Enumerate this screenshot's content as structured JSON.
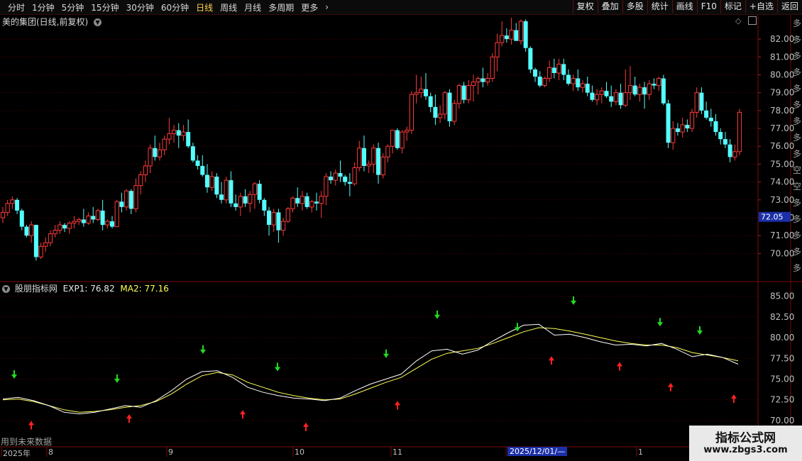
{
  "toolbar": {
    "periods": [
      "分时",
      "1分钟",
      "5分钟",
      "15分钟",
      "30分钟",
      "60分钟",
      "日线",
      "周线",
      "月线",
      "多周期",
      "更多"
    ],
    "active_period": "日线",
    "right_buttons": [
      "复权",
      "叠加",
      "多股",
      "统计",
      "画线",
      "F10",
      "标记",
      "+自选",
      "返回"
    ]
  },
  "main_panel": {
    "title": "美的集团(日线,前复权)",
    "price_axis": [
      "82.00",
      "81.00",
      "80.00",
      "79.00",
      "78.00",
      "77.00",
      "76.00",
      "75.00",
      "74.00",
      "73.00",
      "72.00",
      "71.00",
      "70.00"
    ],
    "current_price_tag": "72.05",
    "side_text": "多多多多多多多多多空空多多多多多多多多多"
  },
  "indicator_panel": {
    "name": "股朋指标网",
    "exp1_label": "EXP1:",
    "exp1_value": "76.82",
    "ma2_label": "MA2:",
    "ma2_value": "77.16",
    "axis": [
      "85.00",
      "82.50",
      "80.00",
      "77.50",
      "75.00",
      "72.50",
      "70.00"
    ],
    "note": "用到未来数据"
  },
  "date_axis": {
    "labels": [
      "2025年",
      "8",
      "9",
      "10",
      "11",
      "2025/12/01/—",
      "1"
    ]
  },
  "watermark": {
    "line1": "指标公式网",
    "line2": "www.zbgs3.com"
  },
  "colors": {
    "up": "#ff3b3b",
    "down": "#54ffff",
    "exp_line": "#ffffff",
    "ma_line": "#ffff55",
    "buy_arrow": "#ff2222",
    "sell_arrow": "#22dd22",
    "grid": "#5a0000"
  },
  "chart_data": {
    "type": "candlestick",
    "candles_ohlc": [
      [
        72.0,
        72.6,
        71.7,
        72.3
      ],
      [
        72.3,
        73.0,
        72.1,
        72.8
      ],
      [
        72.8,
        73.2,
        72.5,
        73.0
      ],
      [
        73.0,
        73.1,
        72.2,
        72.4
      ],
      [
        72.4,
        72.5,
        71.3,
        71.5
      ],
      [
        71.5,
        71.6,
        70.9,
        71.0
      ],
      [
        71.0,
        71.8,
        70.6,
        71.6
      ],
      [
        71.6,
        71.6,
        69.6,
        69.8
      ],
      [
        69.8,
        70.6,
        69.7,
        70.4
      ],
      [
        70.4,
        70.9,
        70.1,
        70.6
      ],
      [
        70.6,
        71.3,
        70.4,
        71.1
      ],
      [
        71.1,
        71.6,
        70.9,
        71.3
      ],
      [
        71.3,
        71.8,
        71.1,
        71.6
      ],
      [
        71.6,
        71.7,
        71.2,
        71.4
      ],
      [
        71.4,
        71.8,
        71.1,
        71.7
      ],
      [
        71.7,
        72.1,
        71.4,
        71.8
      ],
      [
        71.8,
        72.0,
        71.6,
        71.9
      ],
      [
        71.9,
        72.5,
        71.5,
        71.7
      ],
      [
        71.7,
        72.3,
        71.6,
        72.1
      ],
      [
        72.1,
        72.6,
        71.7,
        71.9
      ],
      [
        71.9,
        72.5,
        71.8,
        72.4
      ],
      [
        72.4,
        73.0,
        71.3,
        71.6
      ],
      [
        71.6,
        71.9,
        71.4,
        71.8
      ],
      [
        71.8,
        72.1,
        71.4,
        71.5
      ],
      [
        71.5,
        73.0,
        71.5,
        72.9
      ],
      [
        72.9,
        73.4,
        72.3,
        72.6
      ],
      [
        72.6,
        73.6,
        72.4,
        73.5
      ],
      [
        73.5,
        73.6,
        72.2,
        72.5
      ],
      [
        72.5,
        74.2,
        72.3,
        73.8
      ],
      [
        73.8,
        74.6,
        73.3,
        74.4
      ],
      [
        74.4,
        75.2,
        74.0,
        74.9
      ],
      [
        74.9,
        76.1,
        74.5,
        75.9
      ],
      [
        75.9,
        76.6,
        75.2,
        75.4
      ],
      [
        75.4,
        76.2,
        75.2,
        75.8
      ],
      [
        75.8,
        76.6,
        75.5,
        76.4
      ],
      [
        76.4,
        77.6,
        76.1,
        76.7
      ],
      [
        76.7,
        77.2,
        76.2,
        76.9
      ],
      [
        76.9,
        77.3,
        75.9,
        76.6
      ],
      [
        76.6,
        77.2,
        76.3,
        76.8
      ],
      [
        76.8,
        77.5,
        75.9,
        76.0
      ],
      [
        76.0,
        76.2,
        75.1,
        75.2
      ],
      [
        75.2,
        75.5,
        74.7,
        74.9
      ],
      [
        74.9,
        75.5,
        74.3,
        74.4
      ],
      [
        74.4,
        75.0,
        73.4,
        73.7
      ],
      [
        73.7,
        74.6,
        73.5,
        74.3
      ],
      [
        74.3,
        74.5,
        73.1,
        73.3
      ],
      [
        73.3,
        74.0,
        72.8,
        73.0
      ],
      [
        73.0,
        74.3,
        72.8,
        74.1
      ],
      [
        74.1,
        74.6,
        72.6,
        72.8
      ],
      [
        72.8,
        73.3,
        72.4,
        72.6
      ],
      [
        72.6,
        73.4,
        72.1,
        73.2
      ],
      [
        73.2,
        73.6,
        72.6,
        72.8
      ],
      [
        72.8,
        73.5,
        72.3,
        73.3
      ],
      [
        73.3,
        74.0,
        72.5,
        73.9
      ],
      [
        73.9,
        74.1,
        72.8,
        73.0
      ],
      [
        73.0,
        73.1,
        72.1,
        72.4
      ],
      [
        72.4,
        72.6,
        71.0,
        71.6
      ],
      [
        71.6,
        72.5,
        71.2,
        72.3
      ],
      [
        72.3,
        72.5,
        70.6,
        71.3
      ],
      [
        71.3,
        72.0,
        71.0,
        71.8
      ],
      [
        71.8,
        72.6,
        71.7,
        72.5
      ],
      [
        72.5,
        73.2,
        72.3,
        73.1
      ],
      [
        73.1,
        73.7,
        72.6,
        72.8
      ],
      [
        72.8,
        73.5,
        72.4,
        73.2
      ],
      [
        73.2,
        73.4,
        72.5,
        72.6
      ],
      [
        72.6,
        73.0,
        72.3,
        72.9
      ],
      [
        72.9,
        73.4,
        72.4,
        72.8
      ],
      [
        72.8,
        73.5,
        72.0,
        73.2
      ],
      [
        73.2,
        74.5,
        72.7,
        74.3
      ],
      [
        74.3,
        74.6,
        73.9,
        74.1
      ],
      [
        74.1,
        74.7,
        73.8,
        74.5
      ],
      [
        74.5,
        75.2,
        74.0,
        74.3
      ],
      [
        74.3,
        74.4,
        73.8,
        74.0
      ],
      [
        74.0,
        74.5,
        73.2,
        73.9
      ],
      [
        73.9,
        75.1,
        73.8,
        74.8
      ],
      [
        74.8,
        76.3,
        74.6,
        75.9
      ],
      [
        75.9,
        76.6,
        74.6,
        74.9
      ],
      [
        74.9,
        75.2,
        74.5,
        75.0
      ],
      [
        75.0,
        76.1,
        74.5,
        75.9
      ],
      [
        75.9,
        76.2,
        73.9,
        74.4
      ],
      [
        74.4,
        75.6,
        74.2,
        75.4
      ],
      [
        75.4,
        76.1,
        75.1,
        76.0
      ],
      [
        76.0,
        76.9,
        75.6,
        76.9
      ],
      [
        76.9,
        77.0,
        75.8,
        75.9
      ],
      [
        75.9,
        76.9,
        75.6,
        76.8
      ],
      [
        76.8,
        77.1,
        76.3,
        76.9
      ],
      [
        76.9,
        79.1,
        76.7,
        78.9
      ],
      [
        78.9,
        80.0,
        78.4,
        79.0
      ],
      [
        79.0,
        79.9,
        78.7,
        79.2
      ],
      [
        79.2,
        80.1,
        78.6,
        78.8
      ],
      [
        78.8,
        79.0,
        77.9,
        78.2
      ],
      [
        78.2,
        78.9,
        77.2,
        77.6
      ],
      [
        77.6,
        78.3,
        77.3,
        77.8
      ],
      [
        77.8,
        79.1,
        77.5,
        79.0
      ],
      [
        79.0,
        79.2,
        77.1,
        77.4
      ],
      [
        77.4,
        78.6,
        77.2,
        78.4
      ],
      [
        78.4,
        79.5,
        78.1,
        79.4
      ],
      [
        79.4,
        79.6,
        78.4,
        78.6
      ],
      [
        78.6,
        79.7,
        78.4,
        79.4
      ],
      [
        79.4,
        80.0,
        78.5,
        79.6
      ],
      [
        79.6,
        79.9,
        78.9,
        79.8
      ],
      [
        79.8,
        80.4,
        79.3,
        79.6
      ],
      [
        79.6,
        80.1,
        79.4,
        79.8
      ],
      [
        79.8,
        81.2,
        79.6,
        81.0
      ],
      [
        81.0,
        82.3,
        80.2,
        81.8
      ],
      [
        81.8,
        83.0,
        81.6,
        82.2
      ],
      [
        82.2,
        82.6,
        81.8,
        82.0
      ],
      [
        82.0,
        83.2,
        81.7,
        82.5
      ],
      [
        82.5,
        82.9,
        81.9,
        81.9
      ],
      [
        81.9,
        83.1,
        81.7,
        83.0
      ],
      [
        83.0,
        83.1,
        81.3,
        81.5
      ],
      [
        81.5,
        81.6,
        80.1,
        80.3
      ],
      [
        80.3,
        80.4,
        79.6,
        79.9
      ],
      [
        79.9,
        80.2,
        79.3,
        79.4
      ],
      [
        79.4,
        79.9,
        79.3,
        79.8
      ],
      [
        79.8,
        80.8,
        79.6,
        80.4
      ],
      [
        80.4,
        80.9,
        79.8,
        80.1
      ],
      [
        80.1,
        80.9,
        79.7,
        80.6
      ],
      [
        80.6,
        80.9,
        79.7,
        80.0
      ],
      [
        80.0,
        80.3,
        79.4,
        79.5
      ],
      [
        79.5,
        80.0,
        79.1,
        79.8
      ],
      [
        79.8,
        80.3,
        79.1,
        79.3
      ],
      [
        79.3,
        79.7,
        79.0,
        79.5
      ],
      [
        79.5,
        79.9,
        78.8,
        79.0
      ],
      [
        79.0,
        79.4,
        78.5,
        78.6
      ],
      [
        78.6,
        79.2,
        78.3,
        78.9
      ],
      [
        78.9,
        79.3,
        78.4,
        79.1
      ],
      [
        79.1,
        79.6,
        78.7,
        78.8
      ],
      [
        78.8,
        79.4,
        78.2,
        78.5
      ],
      [
        78.5,
        79.2,
        78.3,
        79.0
      ],
      [
        79.0,
        79.5,
        78.1,
        78.3
      ],
      [
        78.3,
        80.3,
        78.2,
        79.0
      ],
      [
        79.0,
        80.5,
        78.6,
        79.4
      ],
      [
        79.4,
        79.9,
        78.8,
        78.9
      ],
      [
        78.9,
        79.5,
        78.5,
        79.3
      ],
      [
        79.3,
        79.6,
        78.1,
        78.9
      ],
      [
        78.9,
        79.7,
        78.6,
        79.5
      ],
      [
        79.5,
        79.8,
        79.2,
        79.4
      ],
      [
        79.4,
        79.9,
        79.1,
        79.8
      ],
      [
        79.8,
        80.0,
        78.3,
        78.4
      ],
      [
        78.4,
        78.6,
        75.9,
        76.2
      ],
      [
        76.2,
        77.4,
        75.8,
        77.0
      ],
      [
        77.0,
        77.3,
        76.6,
        76.8
      ],
      [
        76.8,
        77.6,
        76.5,
        77.2
      ],
      [
        77.2,
        77.5,
        76.8,
        77.0
      ],
      [
        77.0,
        78.1,
        76.8,
        77.9
      ],
      [
        77.9,
        79.3,
        77.6,
        79.0
      ],
      [
        79.0,
        79.3,
        77.8,
        78.0
      ],
      [
        78.0,
        78.5,
        77.5,
        77.6
      ],
      [
        77.6,
        78.1,
        77.1,
        77.4
      ],
      [
        77.4,
        77.8,
        76.6,
        76.8
      ],
      [
        76.8,
        77.0,
        76.1,
        76.4
      ],
      [
        76.4,
        76.8,
        75.9,
        76.1
      ],
      [
        76.1,
        76.4,
        75.1,
        75.4
      ],
      [
        75.4,
        76.1,
        75.2,
        75.7
      ],
      [
        75.7,
        78.1,
        75.5,
        77.9
      ]
    ],
    "exp1_series": [
      72.6,
      72.8,
      72.4,
      71.8,
      71.0,
      70.8,
      71.0,
      71.4,
      71.8,
      71.6,
      72.4,
      73.6,
      75.0,
      75.9,
      76.0,
      75.2,
      74.0,
      73.4,
      73.0,
      72.7,
      72.6,
      72.4,
      72.7,
      73.6,
      74.4,
      75.0,
      75.6,
      77.2,
      78.4,
      78.6,
      78.0,
      78.5,
      79.6,
      80.6,
      81.5,
      81.6,
      80.3,
      80.4,
      80.0,
      79.5,
      79.1,
      79.2,
      79.0,
      79.3,
      78.6,
      77.7,
      78.0,
      77.6,
      76.8
    ],
    "ma2_series": [
      72.5,
      72.6,
      72.3,
      71.8,
      71.3,
      71.0,
      71.1,
      71.3,
      71.6,
      71.8,
      72.3,
      73.2,
      74.4,
      75.4,
      75.8,
      75.5,
      74.6,
      74.0,
      73.4,
      73.0,
      72.7,
      72.5,
      72.6,
      73.2,
      73.9,
      74.6,
      75.2,
      76.3,
      77.4,
      78.1,
      78.4,
      78.7,
      79.3,
      80.0,
      80.7,
      81.2,
      81.1,
      80.8,
      80.4,
      80.0,
      79.6,
      79.3,
      79.1,
      79.1,
      78.8,
      78.2,
      77.9,
      77.6,
      77.2
    ],
    "sell_signal_y": [
      75.3,
      74.8,
      78.3,
      76.2,
      77.8,
      82.5,
      81.0,
      84.2,
      81.6,
      80.6,
      81.0
    ],
    "buy_signal_y": [
      69.7,
      70.5,
      71.0,
      69.5,
      72.1,
      77.5,
      76.8,
      74.3,
      72.9
    ]
  }
}
